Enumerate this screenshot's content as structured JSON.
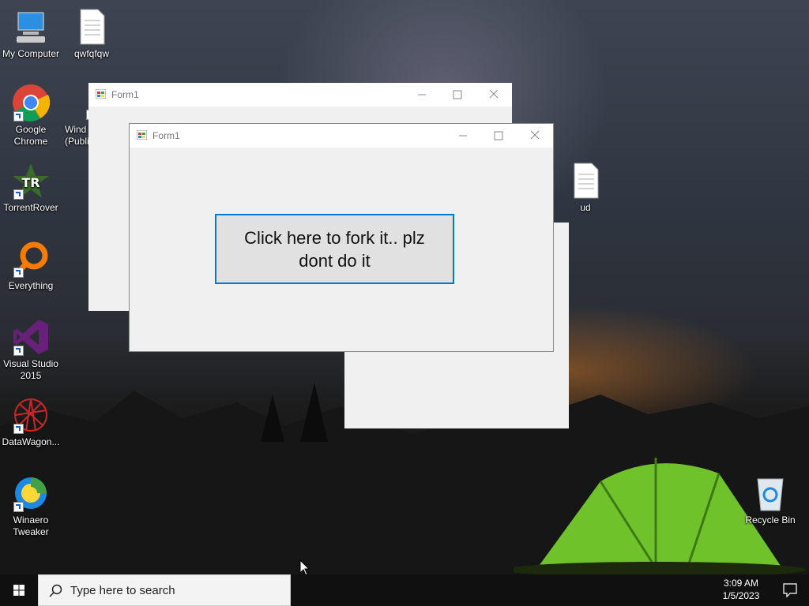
{
  "desktop": {
    "icons": [
      {
        "label": "My Computer",
        "icon": "computer-icon"
      },
      {
        "label": "qwfqfqw",
        "icon": "text-file-icon"
      },
      {
        "label": "Google\nChrome",
        "icon": "chrome-icon"
      },
      {
        "label": "Wind\n(Publi",
        "icon": "windows-app-icon"
      },
      {
        "label": "TorrentRover",
        "icon": "torrentrover-icon"
      },
      {
        "label": "Everything",
        "icon": "everything-search-icon"
      },
      {
        "label": "Visual Studio\n2015",
        "icon": "visual-studio-icon"
      },
      {
        "label": "DataWagon...",
        "icon": "datawagon-icon"
      },
      {
        "label": "Winaero\nTweaker",
        "icon": "winaero-tweaker-icon"
      },
      {
        "label": "ud",
        "icon": "text-file-icon"
      },
      {
        "label": "Recycle Bin",
        "icon": "recycle-bin-icon"
      }
    ]
  },
  "windows": {
    "back": {
      "title": "Form1"
    },
    "front": {
      "title": "Form1",
      "button_label": "Click here to fork it.. plz dont do it"
    }
  },
  "taskbar": {
    "search_placeholder": "Type here to search",
    "time": "3:09 AM",
    "date": "1/5/2023"
  },
  "colors": {
    "accent": "#0078d7",
    "taskbar": "#101010",
    "window_bg": "#f0f0f0"
  }
}
